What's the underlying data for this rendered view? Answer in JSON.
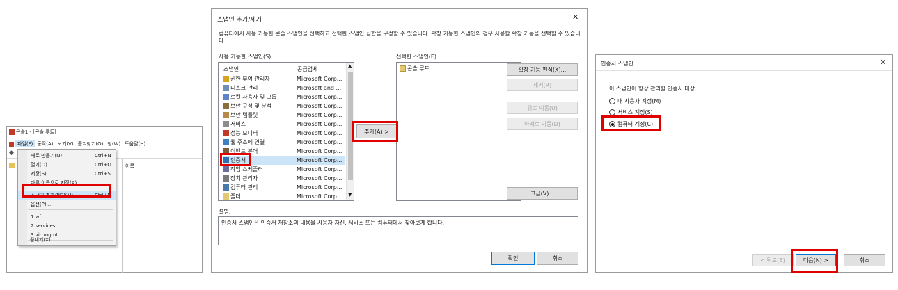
{
  "panel1": {
    "title": "콘솔1 - [콘솔 루트]",
    "menubar": [
      "파일(F)",
      "동작(A)",
      "보기(V)",
      "즐겨찾기(O)",
      "창(W)",
      "도움말(H)"
    ],
    "column_header": "이름",
    "file_menu": [
      {
        "label": "새로 만들기(N)",
        "shortcut": "Ctrl+N"
      },
      {
        "label": "열기(O)...",
        "shortcut": "Ctrl+O"
      },
      {
        "label": "저장(S)",
        "shortcut": "Ctrl+S"
      },
      {
        "label": "다른 이름으로 저장(A)...",
        "shortcut": ""
      },
      {
        "label": "스냅인 추가/제거(M)...",
        "shortcut": "Ctrl+M"
      },
      {
        "label": "옵션(P)...",
        "shortcut": ""
      },
      {
        "label": "1 wf",
        "shortcut": ""
      },
      {
        "label": "2 services",
        "shortcut": ""
      },
      {
        "label": "3 virtmgmt",
        "shortcut": ""
      },
      {
        "label": "끝내기(X)",
        "shortcut": ""
      }
    ]
  },
  "panel2": {
    "title": "스냅인 추가/제거",
    "close": "✕",
    "description": "컴퓨터에서 사용 가능한 콘솔 스냅인을 선택하고 선택한 스냅인 집합을 구성할 수 있습니다. 확장 가능한 스냅인의 경우 사용할 확장 기능을 선택할 수 있습니다.",
    "available_label": "사용 가능한 스냅인(S):",
    "col_snapin": "스냅인",
    "col_vendor": "공급업체",
    "snapins": [
      {
        "name": "권한 부여 관리자",
        "vendor": "Microsoft Corp..."
      },
      {
        "name": "디스크 관리",
        "vendor": "Microsoft and ..."
      },
      {
        "name": "로컬 사용자 및 그룹",
        "vendor": "Microsoft Corp..."
      },
      {
        "name": "보안 구성 및 분석",
        "vendor": "Microsoft Corp..."
      },
      {
        "name": "보안 템플릿",
        "vendor": "Microsoft Corp..."
      },
      {
        "name": "서비스",
        "vendor": "Microsoft Corp..."
      },
      {
        "name": "성능 모니터",
        "vendor": "Microsoft Corp..."
      },
      {
        "name": "웹 주소에 연결",
        "vendor": "Microsoft Corp..."
      },
      {
        "name": "이벤트 뷰어",
        "vendor": "Microsoft Corp..."
      },
      {
        "name": "인증서",
        "vendor": "Microsoft Corp..."
      },
      {
        "name": "작업 스케줄러",
        "vendor": "Microsoft Corp..."
      },
      {
        "name": "장치 관리자",
        "vendor": "Microsoft Corp..."
      },
      {
        "name": "컴퓨터 관리",
        "vendor": "Microsoft Corp..."
      },
      {
        "name": "폴더",
        "vendor": "Microsoft Corp..."
      }
    ],
    "add_button": "추가(A) >",
    "selected_label": "선택한 스냅인(E):",
    "selected_items": [
      "콘솔 루트"
    ],
    "edit_ext": "확장 기능 편집(X)...",
    "remove": "제거(R)",
    "move_up": "위로 이동(U)",
    "move_down": "아래로 이동(D)",
    "advanced": "고급(V)...",
    "desc_label": "설명:",
    "desc_text": "인증서 스냅인은 인증서 저장소의 내용을 사용자 자신, 서비스 또는 컴퓨터에서 찾아보게 합니다.",
    "ok": "확인",
    "cancel": "취소"
  },
  "panel3": {
    "title": "인증서 스냅인",
    "close": "✕",
    "prompt": "이 스냅인이 항상 관리할 인증서 대상:",
    "options": [
      {
        "label": "내 사용자 계정(M)",
        "checked": false
      },
      {
        "label": "서비스 계정(S)",
        "checked": false
      },
      {
        "label": "컴퓨터 계정(C)",
        "checked": true
      }
    ],
    "back": "< 뒤로(B)",
    "next": "다음(N) >",
    "cancel": "취소"
  },
  "colors": {
    "highlight": "#e00000",
    "accent": "#0078d7"
  }
}
